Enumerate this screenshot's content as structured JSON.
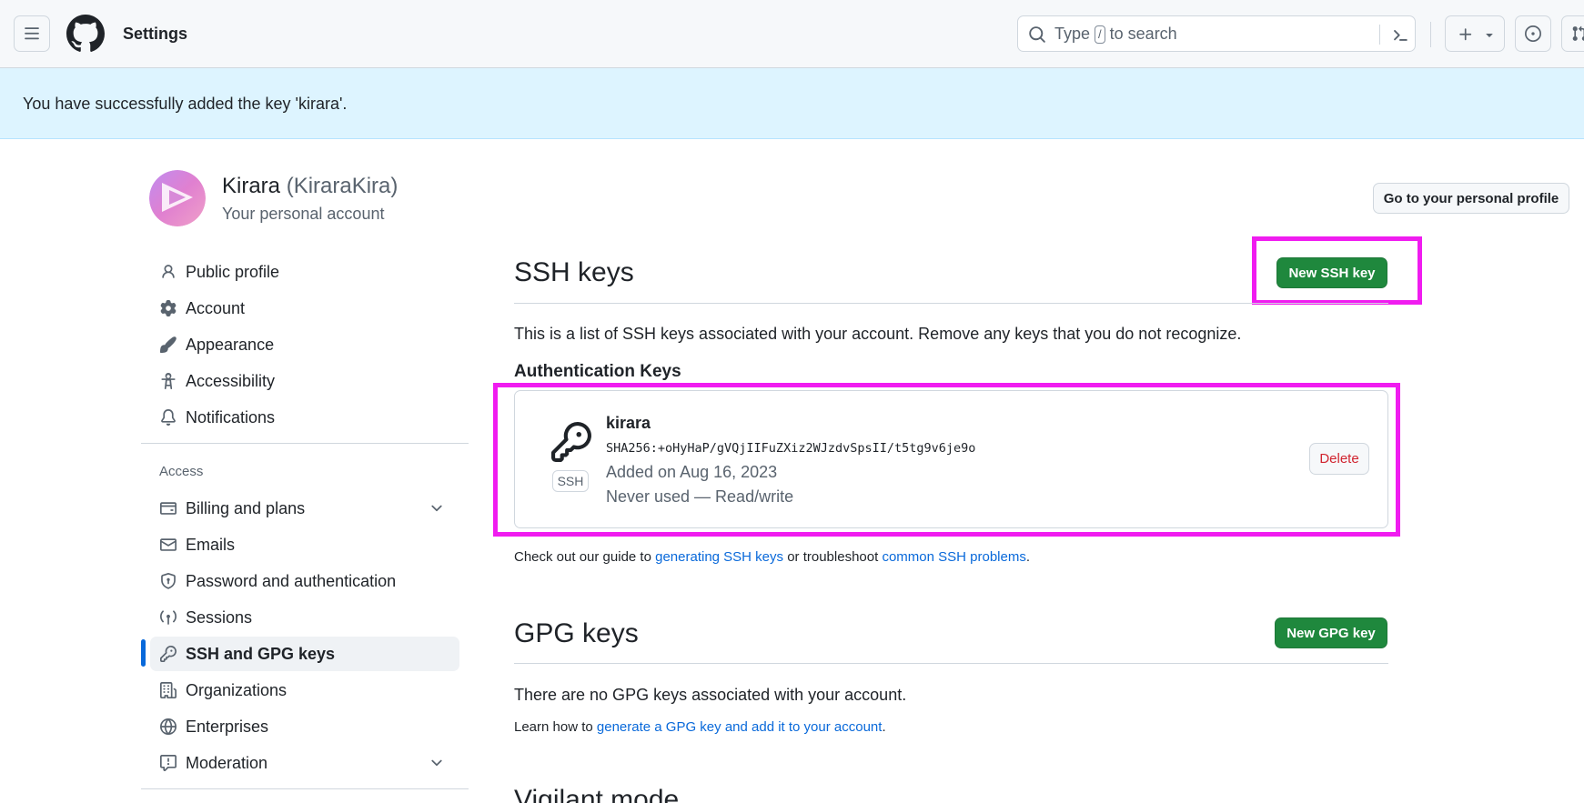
{
  "header": {
    "title": "Settings",
    "search": {
      "prefix": "Type",
      "key": "/",
      "suffix": "to search"
    }
  },
  "flash": {
    "message": "You have successfully added the key 'kirara'."
  },
  "account": {
    "name": "Kirara",
    "login": "(KiraraKira)",
    "subtitle": "Your personal account",
    "profile_button": "Go to your personal profile"
  },
  "sidebar": {
    "items": [
      {
        "label": "Public profile"
      },
      {
        "label": "Account"
      },
      {
        "label": "Appearance"
      },
      {
        "label": "Accessibility"
      },
      {
        "label": "Notifications"
      }
    ],
    "access_heading": "Access",
    "access_items": [
      {
        "label": "Billing and plans"
      },
      {
        "label": "Emails"
      },
      {
        "label": "Password and authentication"
      },
      {
        "label": "Sessions"
      },
      {
        "label": "SSH and GPG keys"
      },
      {
        "label": "Organizations"
      },
      {
        "label": "Enterprises"
      },
      {
        "label": "Moderation"
      }
    ],
    "active": "SSH and GPG keys"
  },
  "ssh": {
    "title": "SSH keys",
    "new_button": "New SSH key",
    "description": "This is a list of SSH keys associated with your account. Remove any keys that you do not recognize.",
    "auth_heading": "Authentication Keys",
    "key": {
      "title": "kirara",
      "badge": "SSH",
      "fingerprint": "SHA256:+oHyHaP/gVQjIIFuZXiz2WJzdvSpsII/t5tg9v6je9o",
      "added": "Added on Aug 16, 2023",
      "usage": "Never used — Read/write",
      "delete_button": "Delete"
    },
    "guide": {
      "prefix": "Check out our guide to",
      "link1": "generating SSH keys",
      "middle": "or troubleshoot",
      "link2": "common SSH problems",
      "suffix": "."
    }
  },
  "gpg": {
    "title": "GPG keys",
    "new_button": "New GPG key",
    "empty": "There are no GPG keys associated with your account.",
    "learn_prefix": "Learn how to",
    "learn_link": "generate a GPG key and add it to your account",
    "learn_suffix": "."
  },
  "vigilant": {
    "title": "Vigilant mode"
  },
  "colors": {
    "accent": "#0969da",
    "primary_button": "#1f883d",
    "danger": "#d1242f",
    "flash_bg": "#ddf4ff",
    "highlight": "#f01cf0"
  }
}
